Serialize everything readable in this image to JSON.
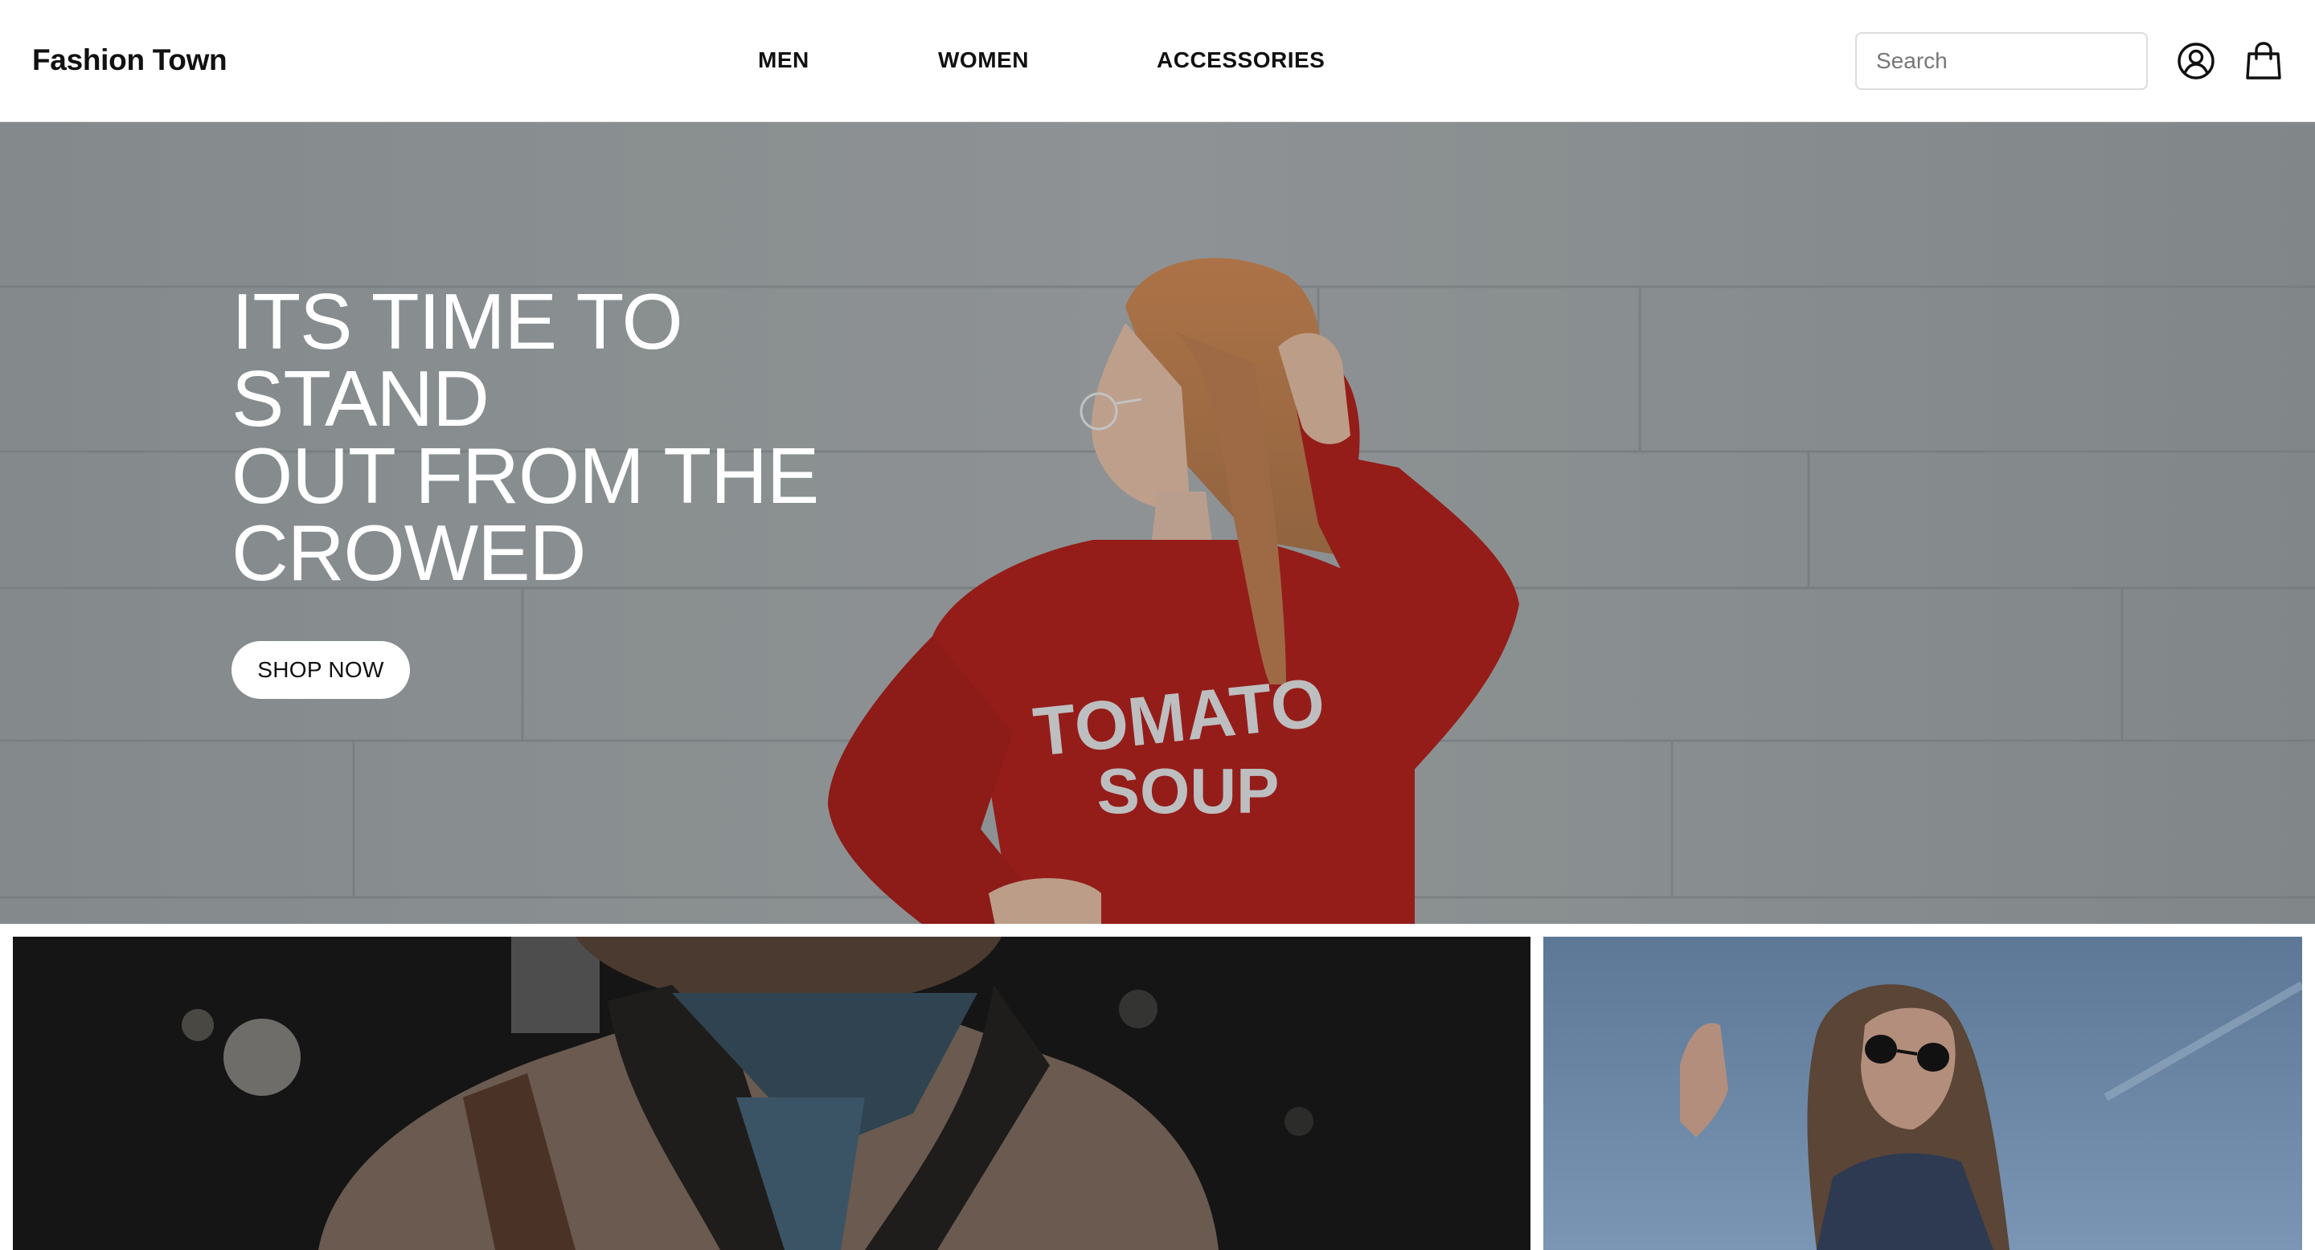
{
  "header": {
    "brand": "Fashion Town",
    "nav": [
      "MEN",
      "WOMEN",
      "ACCESSORIES"
    ],
    "search": {
      "placeholder": "Search",
      "value": ""
    },
    "icons": {
      "account": "user-circle-icon",
      "cart": "shopping-bag-icon"
    }
  },
  "hero": {
    "title_lines": [
      "ITS TIME TO STAND",
      "OUT FROM THE",
      "CROWED"
    ],
    "cta": "SHOP NOW",
    "sweater_print": [
      "TOMATO",
      "SOUP"
    ],
    "colors": {
      "overlay": "#8c9294",
      "sweater": "#9e1f1b"
    }
  },
  "tiles": [
    {
      "name": "men-tile"
    },
    {
      "name": "women-tile"
    }
  ]
}
